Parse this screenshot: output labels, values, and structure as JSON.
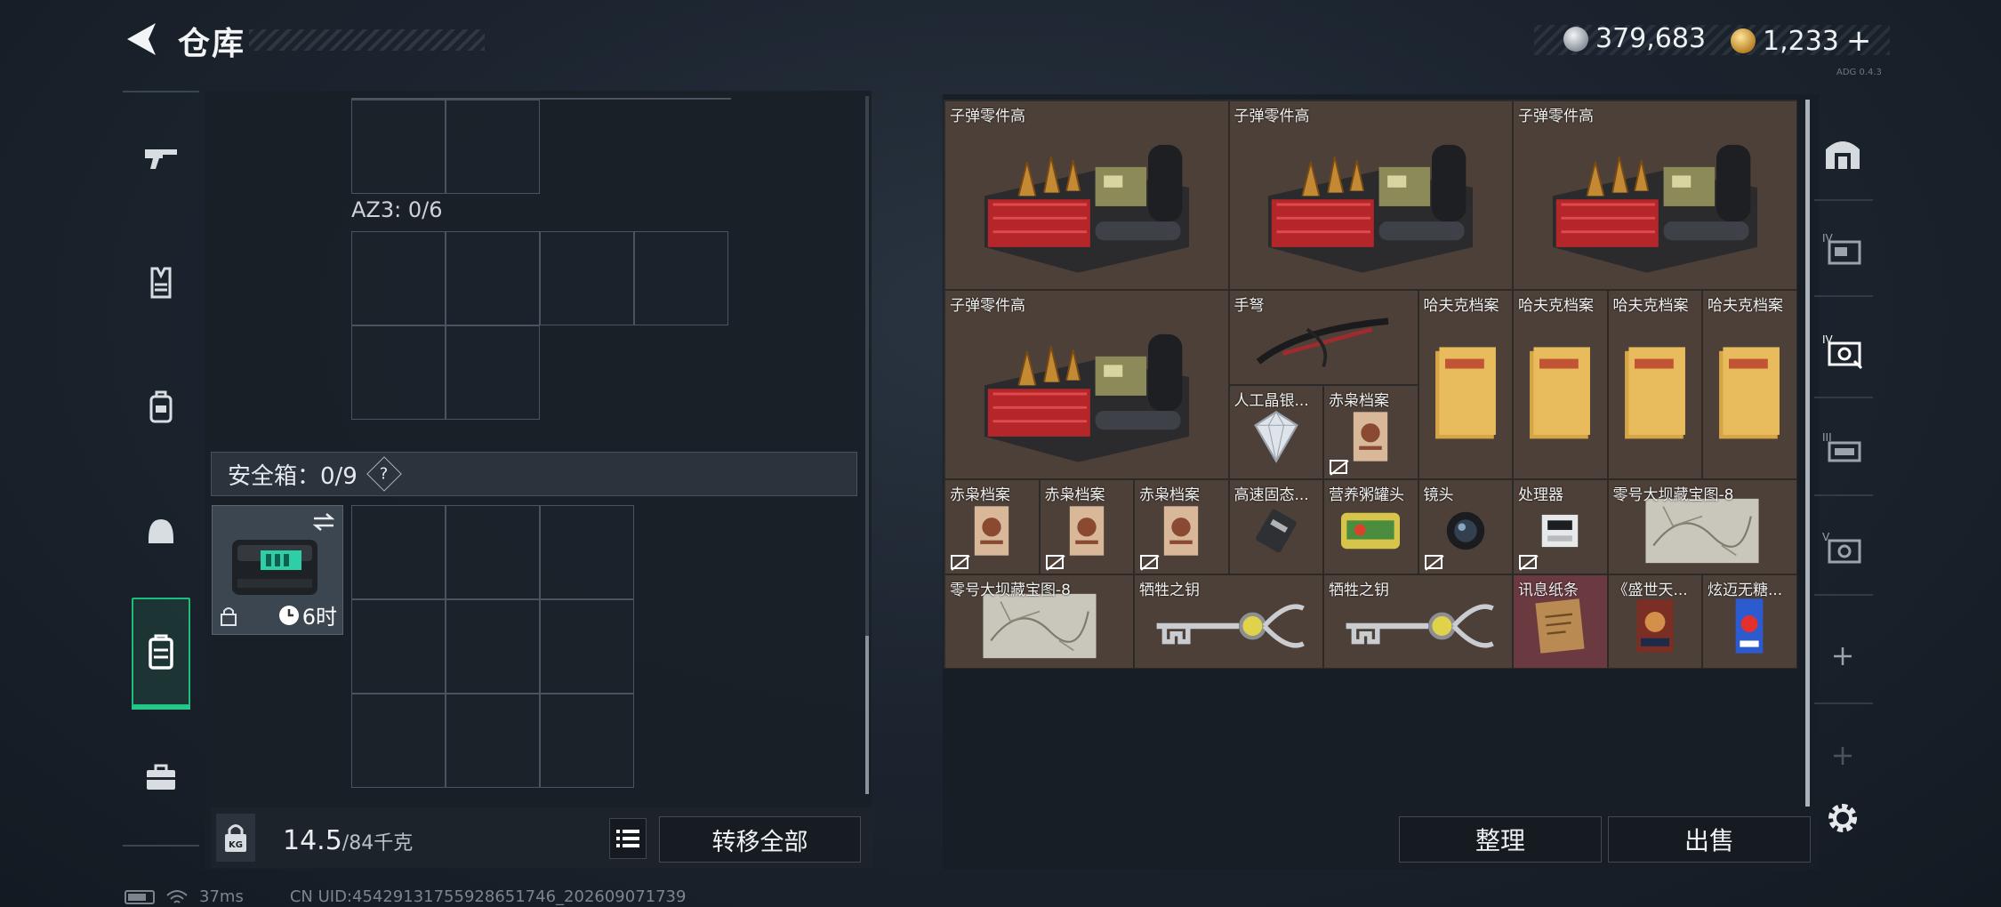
{
  "header": {
    "title": "仓库",
    "currency_silver": "379,683",
    "currency_gold": "1,233",
    "currency_add": "+",
    "version_tag": "ADG 0.4.3"
  },
  "colors": {
    "accent_green": "#1fbd7d",
    "slot_brown": "#4d4038",
    "slot_red": "#6a3a40"
  },
  "left_nav": {
    "items": [
      {
        "id": "weapons",
        "icon": "gun-icon"
      },
      {
        "id": "armor",
        "icon": "vest-icon"
      },
      {
        "id": "chest-rig",
        "icon": "chest-rig-icon"
      },
      {
        "id": "helmet",
        "icon": "helmet-icon"
      },
      {
        "id": "backpack",
        "icon": "backpack-icon",
        "active": true
      },
      {
        "id": "case",
        "icon": "briefcase-icon"
      }
    ]
  },
  "container": {
    "az3_label": "AZ3: 0/6",
    "safebox_label": "安全箱：0/9",
    "help": "?",
    "safebox_timer": "6时",
    "weight_value": "14.5",
    "weight_max": "/84千克",
    "transfer_all": "转移全部"
  },
  "stash": {
    "items": [
      {
        "label": "子弹零件高",
        "art": "parts"
      },
      {
        "label": "子弹零件高",
        "art": "parts"
      },
      {
        "label": "子弹零件高",
        "art": "parts"
      },
      {
        "label": "子弹零件高",
        "art": "parts"
      },
      {
        "label": "手弩",
        "art": "crossbow"
      },
      {
        "label": "哈夫克档案",
        "art": "folder"
      },
      {
        "label": "哈夫克档案",
        "art": "folder"
      },
      {
        "label": "哈夫克档案",
        "art": "folder"
      },
      {
        "label": "哈夫克档案",
        "art": "folder"
      },
      {
        "label": "人工晶银...",
        "art": "gem"
      },
      {
        "label": "赤枭档案",
        "art": "doc",
        "locked": true
      },
      {
        "label": "赤枭档案",
        "art": "doc",
        "locked": true
      },
      {
        "label": "赤枭档案",
        "art": "doc",
        "locked": true
      },
      {
        "label": "赤枭档案",
        "art": "doc",
        "locked": true
      },
      {
        "label": "高速固态...",
        "art": "ssd"
      },
      {
        "label": "营养粥罐头",
        "art": "can"
      },
      {
        "label": "镜头",
        "art": "lens",
        "locked": true
      },
      {
        "label": "处理器",
        "art": "cpu",
        "locked": true
      },
      {
        "label": "零号大坝藏宝图-8",
        "art": "map"
      },
      {
        "label": "零号大坝藏宝图-8",
        "art": "map"
      },
      {
        "label": "牺牲之钥",
        "art": "key"
      },
      {
        "label": "牺牲之钥",
        "art": "key"
      },
      {
        "label": "讯息纸条",
        "art": "note",
        "red": true
      },
      {
        "label": "《盛世天...",
        "art": "book"
      },
      {
        "label": "炫迈无糖...",
        "art": "gum"
      }
    ]
  },
  "right_tabs": [
    {
      "id": "tab-stash-main",
      "icon": "stash-icon"
    },
    {
      "id": "tab-stash-4",
      "icon": "stash-page-4-icon"
    },
    {
      "id": "tab-stash-4b",
      "icon": "stash-page-4b-icon",
      "active": true
    },
    {
      "id": "tab-stash-3",
      "icon": "stash-page-3-icon"
    },
    {
      "id": "tab-stash-5",
      "icon": "stash-page-5-icon"
    },
    {
      "id": "tab-add-1",
      "icon": "plus-icon"
    },
    {
      "id": "tab-add-2",
      "icon": "plus-icon"
    }
  ],
  "actions": {
    "sort": "整理",
    "sell": "出售"
  },
  "status": {
    "ping": "37ms",
    "uid": "CN UID:4542913175592865​1746_202609071739"
  }
}
